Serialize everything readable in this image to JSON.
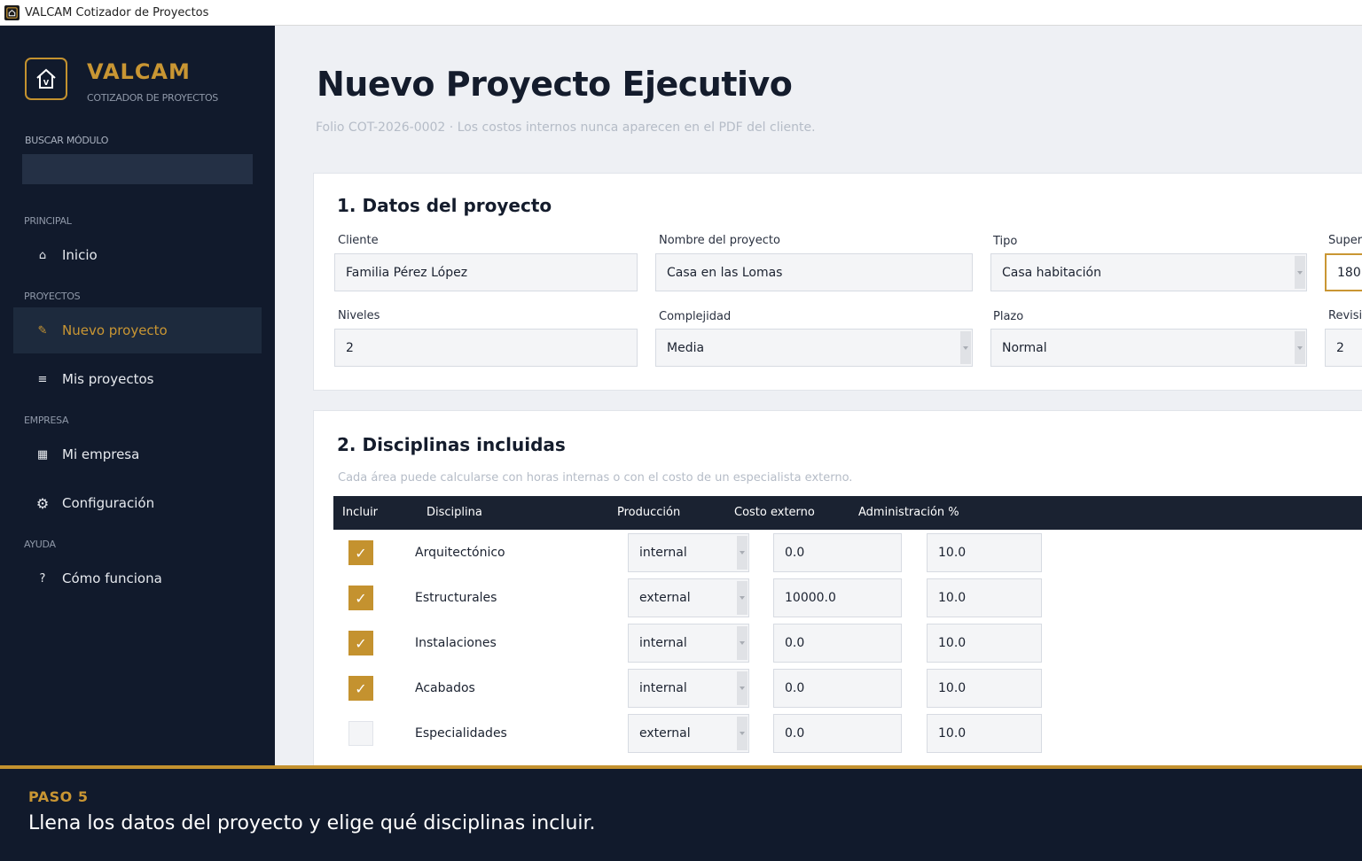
{
  "window": {
    "title": "VALCAM Cotizador de Proyectos"
  },
  "sidebar": {
    "brand_name": "VALCAM",
    "brand_sub": "COTIZADOR DE PROYECTOS",
    "search_label": "BUSCAR MÓDULO",
    "search_placeholder": "",
    "sections": {
      "principal": "PRINCIPAL",
      "proyectos": "PROYECTOS",
      "empresa": "EMPRESA",
      "ayuda": "AYUDA"
    },
    "items": [
      {
        "label": "Inicio",
        "icon": "home-icon",
        "glyph": "⌂"
      },
      {
        "label": "Nuevo proyecto",
        "icon": "pencil-icon",
        "glyph": "✎",
        "active": true
      },
      {
        "label": "Mis proyectos",
        "icon": "list-icon",
        "glyph": "≡"
      },
      {
        "label": "Mi empresa",
        "icon": "building-icon",
        "glyph": "▦"
      },
      {
        "label": "Configuración",
        "icon": "gear-icon",
        "glyph": "⚙"
      },
      {
        "label": "Cómo funciona",
        "icon": "help-icon",
        "glyph": "?"
      }
    ],
    "accent_color": "#c99633"
  },
  "main": {
    "title": "Nuevo Proyecto Ejecutivo",
    "subtitle": "Folio COT-2026-0002 · Los costos internos nunca aparecen en el PDF del cliente.",
    "section1": {
      "title": "1. Datos del proyecto",
      "fields": {
        "cliente": {
          "label": "Cliente",
          "value": "Familia Pérez López"
        },
        "nombre": {
          "label": "Nombre del proyecto",
          "value": "Casa en las Lomas"
        },
        "tipo": {
          "label": "Tipo",
          "value": "Casa habitación"
        },
        "superficie": {
          "label": "Super",
          "value": "180"
        },
        "niveles": {
          "label": "Niveles",
          "value": "2"
        },
        "complejidad": {
          "label": "Complejidad",
          "value": "Media"
        },
        "plazo": {
          "label": "Plazo",
          "value": "Normal"
        },
        "revisiones": {
          "label": "Revisi",
          "value": "2"
        }
      }
    },
    "section2": {
      "title": "2. Disciplinas incluidas",
      "subtitle": "Cada área puede calcularse con horas internas o con el costo de un especialista externo.",
      "columns": [
        "Incluir",
        "Disciplina",
        "Producción",
        "Costo externo",
        "Administración %"
      ],
      "rows": [
        {
          "included": true,
          "check": "✓",
          "discipline": "Arquitectónico",
          "production": "internal",
          "external_cost": "0.0",
          "admin": "10.0"
        },
        {
          "included": true,
          "check": "✓",
          "discipline": "Estructurales",
          "production": "external",
          "external_cost": "10000.0",
          "admin": "10.0"
        },
        {
          "included": true,
          "check": "✓",
          "discipline": "Instalaciones",
          "production": "internal",
          "external_cost": "0.0",
          "admin": "10.0"
        },
        {
          "included": true,
          "check": "✓",
          "discipline": "Acabados",
          "production": "internal",
          "external_cost": "0.0",
          "admin": "10.0"
        },
        {
          "included": false,
          "check": "",
          "discipline": "Especialidades",
          "production": "external",
          "external_cost": "0.0",
          "admin": "10.0"
        }
      ]
    }
  },
  "banner": {
    "step": "PASO 5",
    "text": "Llena los datos del proyecto y elige qué disciplinas incluir."
  }
}
